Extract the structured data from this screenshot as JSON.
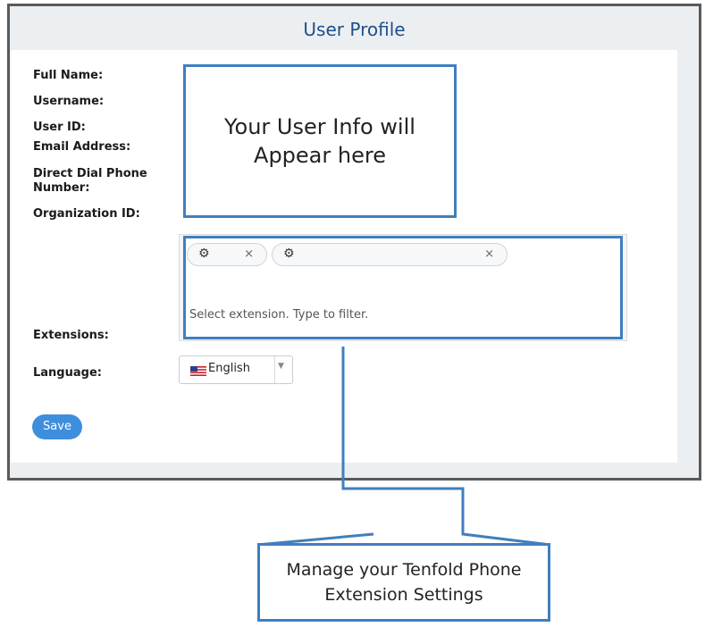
{
  "header": {
    "title": "User Profile"
  },
  "form": {
    "labels": {
      "full_name": "Full Name:",
      "username": "Username:",
      "user_id": "User ID:",
      "email": "Email Address:",
      "direct_dial": "Direct Dial Phone Number:",
      "organization_id": "Organization ID:",
      "extensions": "Extensions:",
      "language": "Language:"
    },
    "extensions": {
      "chips": [
        {
          "icon": "gear-icon",
          "remove": "×"
        },
        {
          "icon": "gear-icon",
          "remove": "×"
        }
      ],
      "placeholder": "Select extension. Type to filter."
    },
    "language": {
      "selected": "English",
      "flag": "us-flag-icon",
      "arrow": "▼"
    },
    "save_label": "Save"
  },
  "annotations": {
    "info_callout": "Your User Info will Appear here",
    "extension_callout": "Manage your Tenfold Phone Extension Settings"
  },
  "colors": {
    "accent": "#3e8ede",
    "callout_border": "#3f7fbf",
    "title": "#1f4f8a"
  }
}
